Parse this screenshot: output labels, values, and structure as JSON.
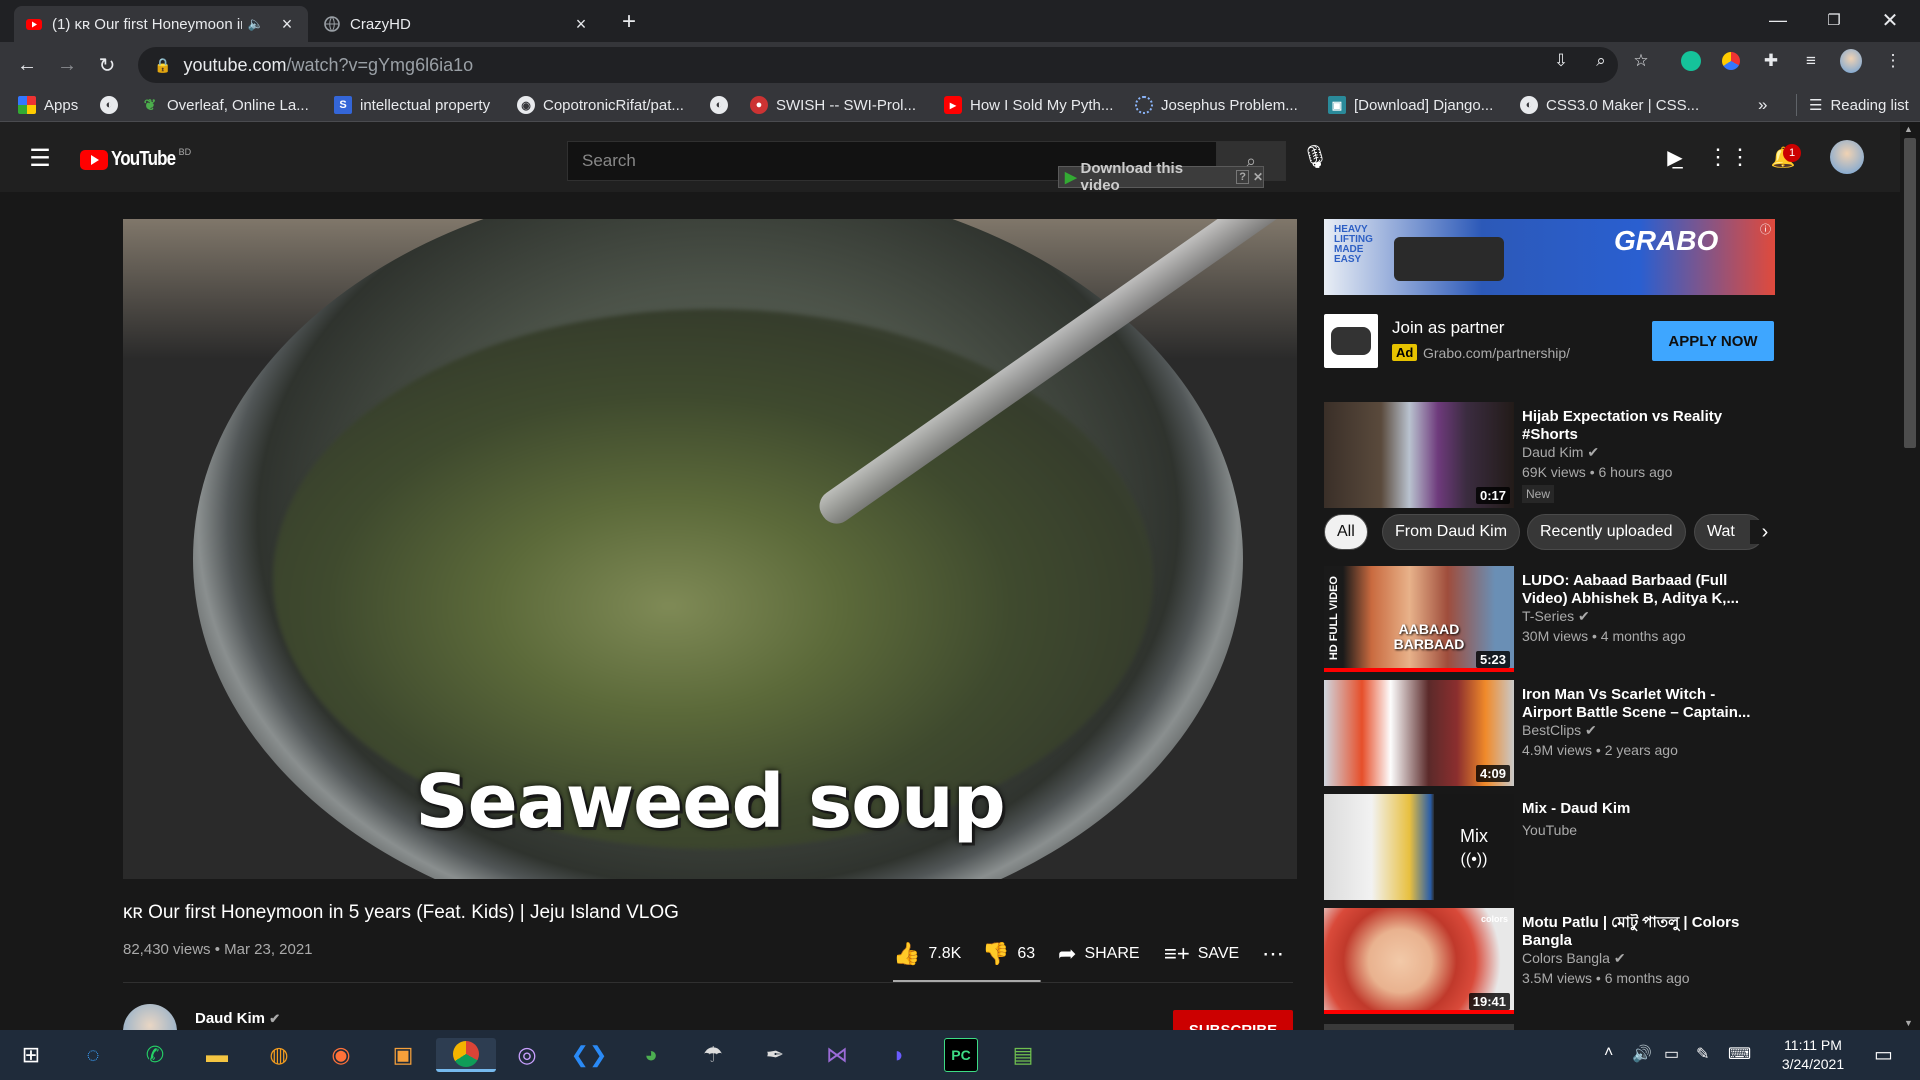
{
  "browser": {
    "tabs": [
      {
        "title": "(1) ᴋʀ Our first Honeymoon in",
        "active": true,
        "favicon": "youtube-icon"
      },
      {
        "title": "CrazyHD",
        "active": false,
        "favicon": "globe-icon"
      }
    ],
    "new_tab_glyph": "+",
    "url_host": "youtube.com",
    "url_path": "/watch?v=gYmg6l6ia1o",
    "bookmarks": [
      {
        "label": "Apps",
        "icon": "apps-grid-icon"
      },
      {
        "label": "",
        "icon": "globe-icon"
      },
      {
        "label": "Overleaf, Online La...",
        "icon": "overleaf-icon"
      },
      {
        "label": "intellectual property",
        "icon": "s-icon"
      },
      {
        "label": "CopotronicRifat/pat...",
        "icon": "github-icon"
      },
      {
        "label": "",
        "icon": "globe-icon"
      },
      {
        "label": "SWISH -- SWI-Prol...",
        "icon": "swish-icon"
      },
      {
        "label": "How I Sold My Pyth...",
        "icon": "youtube-icon"
      },
      {
        "label": "Josephus Problem...",
        "icon": "loading-icon"
      },
      {
        "label": "[Download] Django...",
        "icon": "image-icon"
      },
      {
        "label": "CSS3.0 Maker | CSS...",
        "icon": "globe-icon"
      }
    ],
    "more_glyph": "»",
    "reading_list": "Reading list"
  },
  "youtube": {
    "logo_text": "YouTube",
    "country": "BD",
    "search_placeholder": "Search",
    "download_bar": "Download this video",
    "notification_count": "1"
  },
  "video": {
    "caption_overlay": "Seaweed soup",
    "title": "ᴋʀ Our first Honeymoon in 5 years (Feat. Kids) | Jeju Island VLOG",
    "meta": "82,430 views • Mar 23, 2021",
    "likes": "7.8K",
    "dislikes": "63",
    "like_ratio": 0.992,
    "share": "SHARE",
    "save": "SAVE",
    "channel": "Daud Kim",
    "subscribe": "SUBSCRIBE"
  },
  "ad": {
    "banner_brand": "GRABO",
    "banner_tag": "HEAVY LIFTING MADE EASY",
    "title": "Join as partner",
    "badge": "Ad",
    "url": "Grabo.com/partnership/",
    "cta": "APPLY NOW"
  },
  "chips": [
    "All",
    "From Daud Kim",
    "Recently uploaded",
    "Wat"
  ],
  "recommendations": [
    {
      "title": "Hijab Expectation vs Reality #Shorts",
      "channel": "Daud Kim",
      "verified": true,
      "stats": "69K views • 6 hours ago",
      "duration": "0:17",
      "badge": "New"
    },
    {
      "title": "LUDO: Aabaad Barbaad (Full Video) Abhishek B, Aditya K,...",
      "channel": "T-Series",
      "verified": true,
      "stats": "30M views • 4 months ago",
      "duration": "5:23",
      "thumb_text": "AABAAD BARBAAD"
    },
    {
      "title": "Iron Man Vs Scarlet Witch - Airport Battle Scene – Captain...",
      "channel": "BestClips",
      "verified": true,
      "stats": "4.9M views • 2 years ago",
      "duration": "4:09"
    },
    {
      "title": "Mix - Daud Kim",
      "channel": "YouTube",
      "verified": false,
      "stats": "",
      "duration": "",
      "mix_label": "Mix"
    },
    {
      "title": "Motu Patlu | মোটু পাতলু | Colors Bangla",
      "channel": "Colors Bangla",
      "verified": true,
      "stats": "3.5M views • 6 months ago",
      "duration": "19:41"
    }
  ],
  "taskbar": {
    "time": "11:11 PM",
    "date": "3/24/2021"
  },
  "colors": {
    "yt_red": "#ff0000",
    "subscribe": "#cc0000",
    "apply": "#3ea6ff"
  }
}
